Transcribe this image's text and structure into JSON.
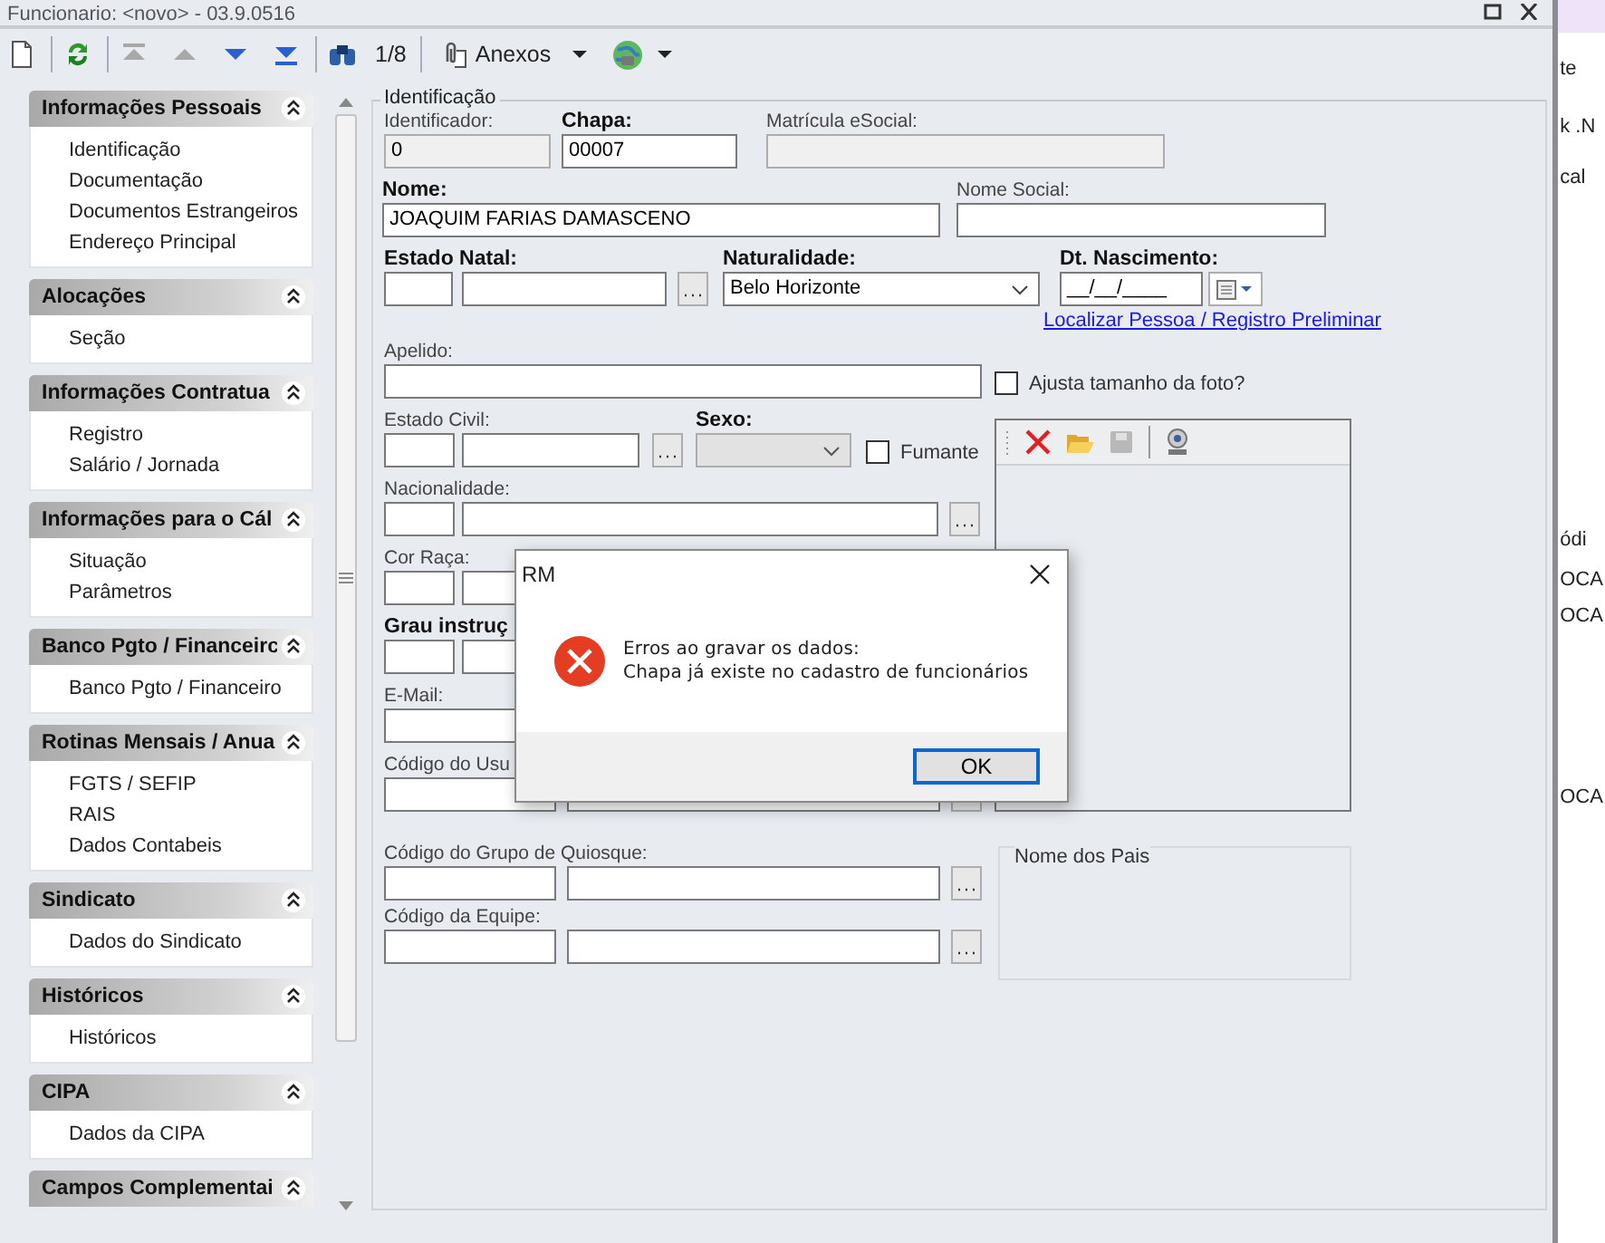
{
  "window": {
    "title": "Funcionario: <novo> - 03.9.0516"
  },
  "toolbar": {
    "buttons": [
      {
        "kind": "new"
      },
      {
        "kind": "refresh"
      },
      {
        "kind": "first",
        "disabled": true
      },
      {
        "kind": "previous",
        "disabled": true
      },
      {
        "kind": "next",
        "disabled": false
      },
      {
        "kind": "last",
        "disabled": false
      },
      {
        "kind": "find"
      }
    ],
    "record_position": "1/8",
    "attachments": "Anexos"
  },
  "sidebar": [
    {
      "title": "Informações Pessoais",
      "expanded": true,
      "items": [
        "Identificação",
        "Documentação",
        "Documentos Estrangeiros",
        "Endereço Principal"
      ]
    },
    {
      "title": "Alocações",
      "expanded": true,
      "items": [
        "Seção"
      ]
    },
    {
      "title": "Informações Contratua",
      "expanded": true,
      "items": [
        "Registro",
        "Salário / Jornada"
      ]
    },
    {
      "title": "Informações para o Cál",
      "expanded": true,
      "items": [
        "Situação",
        "Parâmetros"
      ]
    },
    {
      "title": "Banco Pgto / Financeirc",
      "expanded": true,
      "items": [
        "Banco Pgto / Financeiro"
      ]
    },
    {
      "title": "Rotinas Mensais / Anua",
      "expanded": true,
      "items": [
        "FGTS / SEFIP",
        "RAIS",
        "Dados Contabeis"
      ]
    },
    {
      "title": "Sindicato",
      "expanded": true,
      "items": [
        "Dados do Sindicato"
      ]
    },
    {
      "title": "Históricos",
      "expanded": true,
      "items": [
        "Históricos"
      ]
    },
    {
      "title": "CIPA",
      "expanded": true,
      "items": [
        "Dados da CIPA"
      ]
    },
    {
      "title": "Campos Complementai",
      "expanded": true
    }
  ],
  "form": {
    "section": "Identificação",
    "identificador": {
      "label": "Identificador:",
      "value": "0",
      "disabled": true
    },
    "chapa": {
      "label": "Chapa:",
      "bold": true,
      "value": "00007"
    },
    "matricula_esocial": {
      "label": "Matrícula eSocial:",
      "disabled": true
    },
    "nome": {
      "label": "Nome:",
      "bold": true,
      "value": "JOAQUIM FARIAS DAMASCENO"
    },
    "nome_social": {
      "label": "Nome Social:"
    },
    "estado_natal": {
      "label": "Estado Natal:",
      "bold": true
    },
    "naturalidade": {
      "label": "Naturalidade:",
      "bold": true,
      "value": "Belo Horizonte"
    },
    "dt_nascimento": {
      "label": "Dt. Nascimento:",
      "bold": true,
      "value": "__/__/____"
    },
    "link": "Localizar Pessoa / Registro Preliminar",
    "apelido": {
      "label": "Apelido:"
    },
    "ajusta_foto": {
      "label": "Ajusta tamanho da foto?",
      "checked": false
    },
    "estado_civil": {
      "label": "Estado Civil:"
    },
    "sexo": {
      "label": "Sexo:",
      "bold": true,
      "disabled": true
    },
    "fumante": {
      "label": "Fumante",
      "checked": false
    },
    "nacionalidade": {
      "label": "Nacionalidade:"
    },
    "cor_raca": {
      "label": "Cor Raça:"
    },
    "grau_instrucao": {
      "label": "Grau instruç",
      "bold": true
    },
    "email": {
      "label": "E-Mail:"
    },
    "codigo_usuario": {
      "label": "Código do Usu"
    },
    "codigo_quiosque": {
      "label": "Código do Grupo de Quiosque:"
    },
    "codigo_equipe": {
      "label": "Código da Equipe:"
    },
    "photo_toolbar": [
      {
        "kind": "delete",
        "disabled": false
      },
      {
        "kind": "open",
        "disabled": false
      },
      {
        "kind": "save",
        "disabled": true
      },
      {
        "kind": "webcam",
        "disabled": false
      }
    ],
    "nome_pais": {
      "label": "Nome dos Pais"
    }
  },
  "dialog": {
    "title": "RM",
    "message_lines": [
      "Erros ao gravar os dados:",
      "Chapa já existe no cadastro de funcionários"
    ],
    "button": {
      "label": "OK",
      "default": true
    }
  },
  "background_window": {
    "texts": [
      "te",
      "k .N",
      "cal",
      "ódi",
      "OCA",
      "OCA",
      "OCA"
    ]
  }
}
